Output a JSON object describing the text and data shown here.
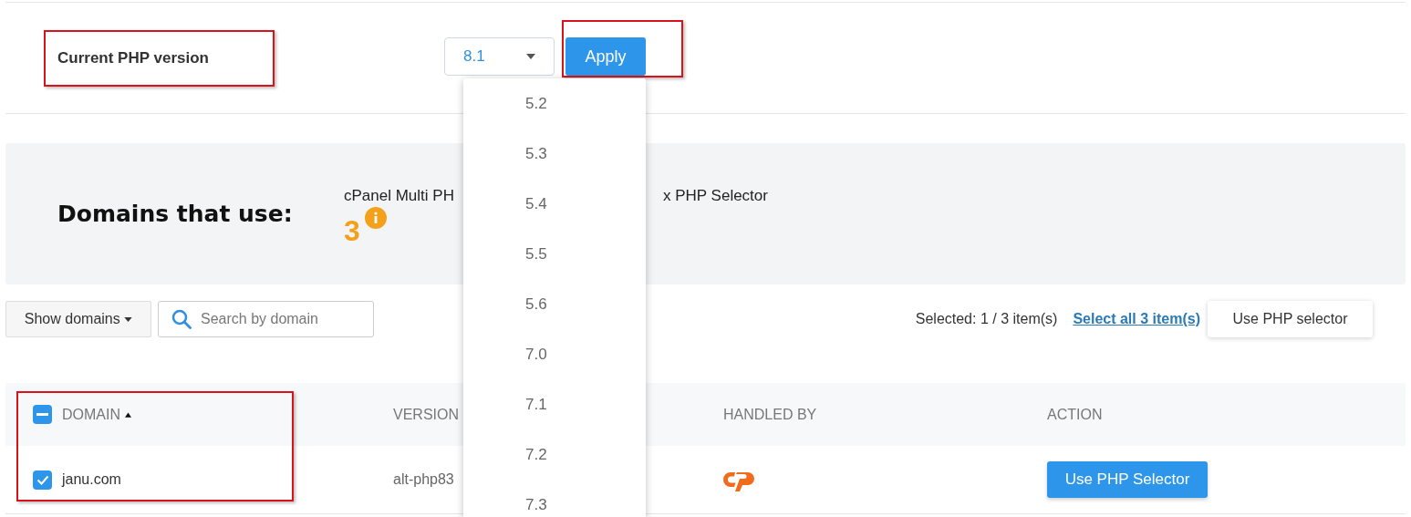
{
  "php_version": {
    "label": "Current PHP version",
    "label_highlighted": true,
    "select": {
      "value": "8.1",
      "expanded": true,
      "options": [
        "5.2",
        "5.3",
        "5.4",
        "5.5",
        "5.6",
        "7.0",
        "7.1",
        "7.2",
        "7.3"
      ]
    },
    "apply_button": "Apply",
    "apply_highlighted": true
  },
  "summary": {
    "title": "Domains that use:",
    "handlers": [
      {
        "text": "cPanel Multi PH",
        "count": "3",
        "info": true
      },
      {
        "text": "x PHP Selector"
      }
    ]
  },
  "toolbar": {
    "filter_button": "Show domains",
    "search": {
      "placeholder": "Search by domain"
    },
    "selection_text": "Selected: 1 / 3 item(s)",
    "select_all_link": "Select all 3 item(s)",
    "action_button": "Use PHP selector"
  },
  "table": {
    "select_all_indeterminate": true,
    "columns": [
      {
        "label": "DOMAIN",
        "sort_ascending": true,
        "highlighted": true
      },
      {
        "label": "VERSION"
      },
      {
        "label": "HANDLED BY"
      },
      {
        "label": "ACTION"
      }
    ],
    "rows": [
      {
        "checked": true,
        "domain": "janu.com",
        "version": "alt-php83",
        "handler": {
          "kind": "cpanel"
        },
        "action": "Use PHP Selector"
      }
    ]
  }
}
